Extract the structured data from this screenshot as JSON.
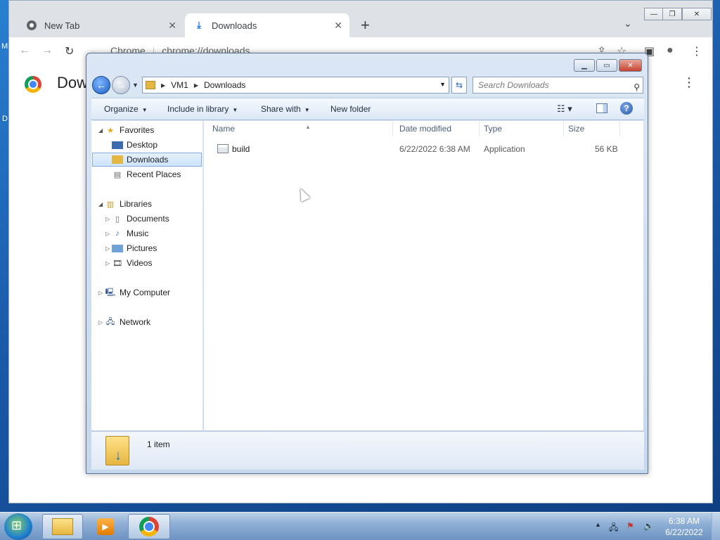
{
  "desktop": {
    "left_labels": [
      "M",
      "D"
    ]
  },
  "chrome": {
    "tabs": [
      {
        "label": "New Tab",
        "icon": "chrome-icon"
      },
      {
        "label": "Downloads",
        "icon": "download-icon"
      }
    ],
    "omnibox_site": "Chrome",
    "omnibox_url": "chrome://downloads",
    "page_title": "Dow"
  },
  "explorer": {
    "breadcrumb": [
      "VM1",
      "Downloads"
    ],
    "search_placeholder": "Search Downloads",
    "commands": {
      "organize": "Organize",
      "include_in_library": "Include in library",
      "share_with": "Share with",
      "new_folder": "New folder"
    },
    "nav": {
      "favorites": "Favorites",
      "desktop": "Desktop",
      "downloads": "Downloads",
      "recent_places": "Recent Places",
      "libraries": "Libraries",
      "documents": "Documents",
      "music": "Music",
      "pictures": "Pictures",
      "videos": "Videos",
      "my_computer": "My Computer",
      "network": "Network"
    },
    "columns": {
      "name": "Name",
      "date_modified": "Date modified",
      "type": "Type",
      "size": "Size"
    },
    "files": [
      {
        "name": "build",
        "date_modified": "6/22/2022 6:38 AM",
        "type": "Application",
        "size": "56 KB"
      }
    ],
    "status": "1 item"
  },
  "taskbar": {
    "time": "6:38 AM",
    "date": "6/22/2022"
  },
  "colors": {
    "desktop_blue": "#1a5aa8",
    "selection": "#cde4fb"
  }
}
